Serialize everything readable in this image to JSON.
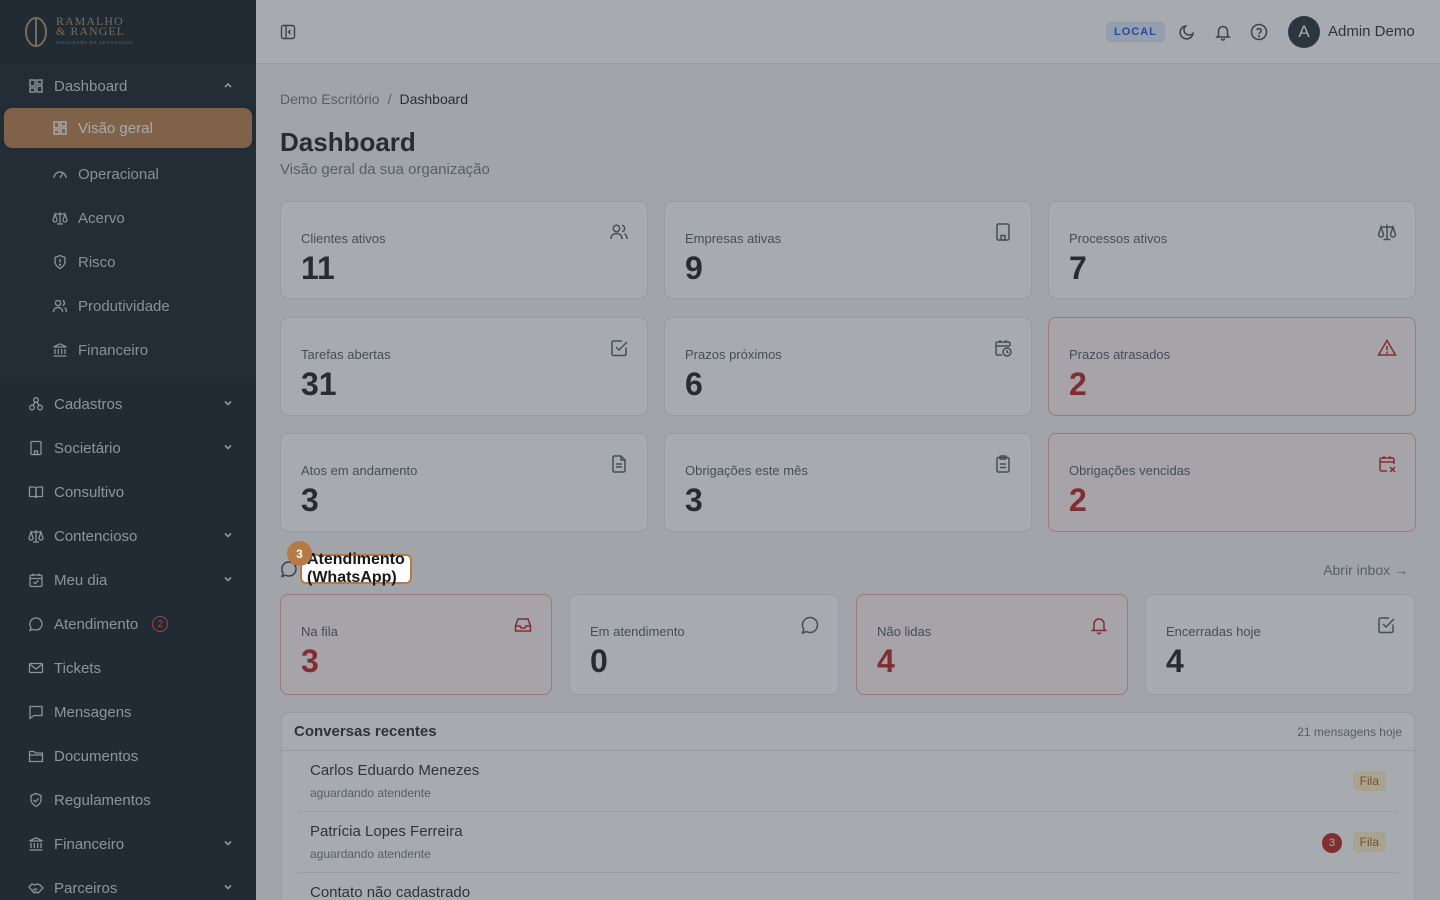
{
  "brand": {
    "line1": "RAMALHO",
    "line2": "& RANGEL",
    "line3": "SOCIEDADE DE ADVOGADOS"
  },
  "sidebar": {
    "dashboard": {
      "label": "Dashboard",
      "items": [
        {
          "label": "Visão geral",
          "icon": "grid-icon",
          "active": true
        },
        {
          "label": "Operacional",
          "icon": "gauge-icon"
        },
        {
          "label": "Acervo",
          "icon": "scale-icon"
        },
        {
          "label": "Risco",
          "icon": "shield-icon"
        },
        {
          "label": "Produtividade",
          "icon": "users-icon"
        },
        {
          "label": "Financeiro",
          "icon": "bank-icon"
        }
      ]
    },
    "items": [
      {
        "label": "Cadastros",
        "icon": "network-icon",
        "expandable": true
      },
      {
        "label": "Societário",
        "icon": "building-icon",
        "expandable": true
      },
      {
        "label": "Consultivo",
        "icon": "book-icon",
        "expandable": false
      },
      {
        "label": "Contencioso",
        "icon": "scale-icon",
        "expandable": true
      },
      {
        "label": "Meu dia",
        "icon": "calendar-icon",
        "expandable": true
      },
      {
        "label": "Atendimento",
        "icon": "chat-icon",
        "expandable": false,
        "badge": "2"
      },
      {
        "label": "Tickets",
        "icon": "ticket-icon",
        "expandable": false
      },
      {
        "label": "Mensagens",
        "icon": "message-icon",
        "expandable": false
      },
      {
        "label": "Documentos",
        "icon": "folder-icon",
        "expandable": false
      },
      {
        "label": "Regulamentos",
        "icon": "shield-check-icon",
        "expandable": false
      },
      {
        "label": "Financeiro",
        "icon": "bank-icon",
        "expandable": true
      },
      {
        "label": "Parceiros",
        "icon": "handshake-icon",
        "expandable": true
      }
    ]
  },
  "header": {
    "env_badge": "LOCAL",
    "avatar_letter": "A",
    "user_name": "Admin Demo"
  },
  "breadcrumb": {
    "root": "Demo Escritório",
    "separator": "/",
    "current": "Dashboard"
  },
  "page": {
    "title": "Dashboard",
    "subtitle": "Visão geral da sua organização"
  },
  "stats": [
    {
      "label": "Clientes ativos",
      "value": "11",
      "icon": "users-icon",
      "alert": false
    },
    {
      "label": "Empresas ativas",
      "value": "9",
      "icon": "building-icon",
      "alert": false
    },
    {
      "label": "Processos ativos",
      "value": "7",
      "icon": "scale-icon",
      "alert": false
    },
    {
      "label": "Tarefas abertas",
      "value": "31",
      "icon": "check-square-icon",
      "alert": false
    },
    {
      "label": "Prazos próximos",
      "value": "6",
      "icon": "calendar-clock-icon",
      "alert": false
    },
    {
      "label": "Prazos atrasados",
      "value": "2",
      "icon": "warning-icon",
      "alert": true
    },
    {
      "label": "Atos em andamento",
      "value": "3",
      "icon": "file-icon",
      "alert": false
    },
    {
      "label": "Obrigações este mês",
      "value": "3",
      "icon": "clipboard-icon",
      "alert": false
    },
    {
      "label": "Obrigações vencidas",
      "value": "2",
      "icon": "calendar-x-icon",
      "alert": true
    }
  ],
  "whatsapp": {
    "title": "Atendimento (WhatsApp)",
    "count": "3",
    "inbox_link": "Abrir inbox →",
    "stats": [
      {
        "label": "Na fila",
        "value": "3",
        "icon": "inbox-icon",
        "alert": true
      },
      {
        "label": "Em atendimento",
        "value": "0",
        "icon": "chat-icon",
        "alert": false
      },
      {
        "label": "Não lidas",
        "value": "4",
        "icon": "bell-icon",
        "alert": true
      },
      {
        "label": "Encerradas hoje",
        "value": "4",
        "icon": "check-square-icon",
        "alert": false
      }
    ]
  },
  "recent": {
    "title": "Conversas recentes",
    "count_text": "21 mensagens hoje",
    "rows": [
      {
        "name": "Carlos Eduardo Menezes",
        "status": "aguardando atendente",
        "tag": "Fila",
        "unread": ""
      },
      {
        "name": "Patrícia Lopes Ferreira",
        "status": "aguardando atendente",
        "tag": "Fila",
        "unread": "3"
      },
      {
        "name": "Contato não cadastrado",
        "status": "",
        "tag": "",
        "unread": ""
      }
    ]
  },
  "colors": {
    "accent": "#b77a44",
    "sidebar_bg": "#0a1720",
    "alert": "#b91c1c",
    "info": "#1d4ed8"
  }
}
